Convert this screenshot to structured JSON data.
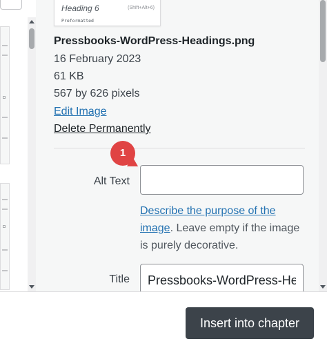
{
  "attachment": {
    "preview": {
      "heading_text": "Heading 6",
      "shortcut_text": "(Shift+Alt+6)",
      "format_text": "Preformatted"
    },
    "filename": "Pressbooks-WordPress-Headings.png",
    "date": "16 February 2023",
    "size": "61 KB",
    "dimensions": "567 by 626 pixels",
    "edit_link": "Edit Image",
    "delete_link": "Delete Permanently"
  },
  "fields": {
    "alt_text": {
      "label": "Alt Text",
      "value": ""
    },
    "help": {
      "link_text": "Describe the purpose of the image",
      "rest_text": ". Leave empty if the image is purely decorative."
    },
    "title": {
      "label": "Title",
      "value": "Pressbooks-WordPress-Headings"
    }
  },
  "callout": {
    "number": "1",
    "color": "#e04444"
  },
  "footer": {
    "insert_button_label": "Insert into chapter"
  },
  "colors": {
    "link": "#2271b1",
    "button_bg": "#3c434a",
    "panel_bg": "#f6f7f7"
  }
}
